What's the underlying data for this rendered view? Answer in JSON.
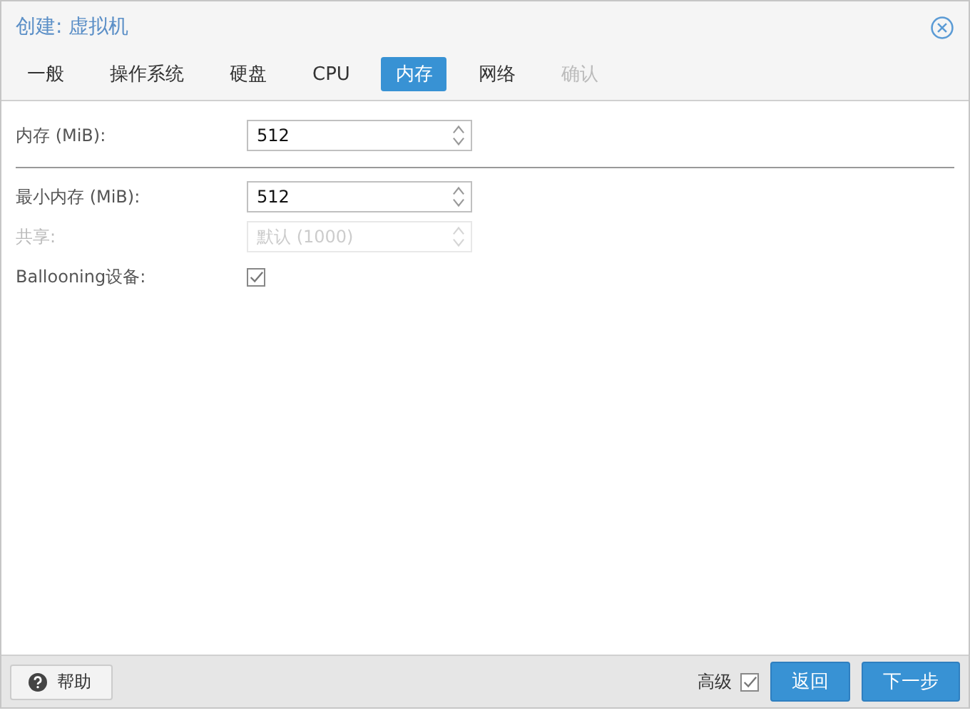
{
  "window": {
    "title": "创建: 虚拟机"
  },
  "tabs": [
    {
      "label": "一般",
      "selected": false,
      "disabled": false
    },
    {
      "label": "操作系统",
      "selected": false,
      "disabled": false
    },
    {
      "label": "硬盘",
      "selected": false,
      "disabled": false
    },
    {
      "label": "CPU",
      "selected": false,
      "disabled": false
    },
    {
      "label": "内存",
      "selected": true,
      "disabled": false
    },
    {
      "label": "网络",
      "selected": false,
      "disabled": false
    },
    {
      "label": "确认",
      "selected": false,
      "disabled": true
    }
  ],
  "sections": [
    [
      {
        "kind": "spinner",
        "label": "内存 (MiB):",
        "value": "512",
        "disabled": false
      }
    ],
    [
      {
        "kind": "spinner",
        "label": "最小内存 (MiB):",
        "value": "512",
        "disabled": false
      },
      {
        "kind": "spinner",
        "label": "共享:",
        "placeholder": "默认 (1000)",
        "disabled": true
      },
      {
        "kind": "checkbox",
        "label": "Ballooning设备:",
        "checked": true
      }
    ]
  ],
  "footer": {
    "help_button": "帮助",
    "advanced": {
      "label": "高级",
      "checked": true
    },
    "buttons": [
      "返回",
      "下一步"
    ]
  }
}
